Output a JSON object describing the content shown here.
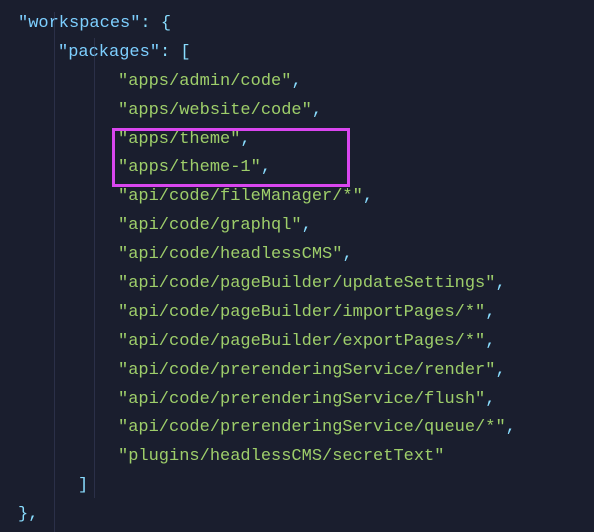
{
  "code": {
    "key_workspaces": "\"workspaces\"",
    "key_packages": "\"packages\"",
    "colon_brace": ": {",
    "colon_bracket": ": [",
    "close_bracket": "]",
    "close_brace_comma": "},",
    "packages": [
      "\"apps/admin/code\"",
      "\"apps/website/code\"",
      "\"apps/theme\"",
      "\"apps/theme-1\"",
      "\"api/code/fileManager/*\"",
      "\"api/code/graphql\"",
      "\"api/code/headlessCMS\"",
      "\"api/code/pageBuilder/updateSettings\"",
      "\"api/code/pageBuilder/importPages/*\"",
      "\"api/code/pageBuilder/exportPages/*\"",
      "\"api/code/prerenderingService/render\"",
      "\"api/code/prerenderingService/flush\"",
      "\"api/code/prerenderingService/queue/*\"",
      "\"plugins/headlessCMS/secretText\""
    ],
    "highlight": {
      "start_index": 2,
      "end_index": 3
    }
  }
}
